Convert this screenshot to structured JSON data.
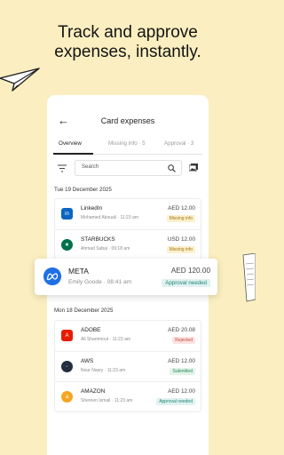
{
  "headline": {
    "line1": "Track and approve",
    "line2": "expenses, instantly."
  },
  "header": {
    "back_glyph": "←",
    "title": "Card expenses"
  },
  "tabs": [
    {
      "label": "Overview",
      "active": true
    },
    {
      "label": "Missing info · 5",
      "active": false
    },
    {
      "label": "Approval · 3",
      "active": false
    }
  ],
  "search": {
    "placeholder": "Search"
  },
  "groups": [
    {
      "date": "Tue 19 December 2025",
      "items": [
        {
          "name": "LinkedIn",
          "sub": "Mohamed Abouali · 11:23 am",
          "amount": "AED 12.00",
          "status": "Missing info",
          "icon": "linkedin-icon",
          "color": "#0a66c2"
        },
        {
          "name": "STARBUCKS",
          "sub": "Ahmad Sabai · 09:18 am",
          "amount": "USD 12.00",
          "status": "Missing info",
          "icon": "starbucks-icon",
          "color": "#00704a"
        }
      ]
    },
    {
      "date": "Mon 18 December 2025",
      "items": [
        {
          "name": "ADOBE",
          "sub": "Ali Shammout · 11:23 am",
          "amount": "AED 20.08",
          "status": "Rejected",
          "icon": "adobe-icon",
          "color": "#e61b00"
        },
        {
          "name": "AWS",
          "sub": "Nour Nasry · 11:23 am",
          "amount": "AED 12.00",
          "status": "Submitted",
          "icon": "aws-icon",
          "color": "#232f3e"
        },
        {
          "name": "AMAZON",
          "sub": "Shereen Ismail · 11:23 am",
          "amount": "AED 12.00",
          "status": "Approval needed",
          "icon": "amazon-icon",
          "color": "#f5a623"
        }
      ]
    }
  ],
  "featured": {
    "name": "META",
    "sub": "Emily Goode · 08:41 am",
    "amount": "AED 120.00",
    "status": "Approval needed",
    "icon": "meta-icon",
    "color": "#1f6fe5"
  }
}
